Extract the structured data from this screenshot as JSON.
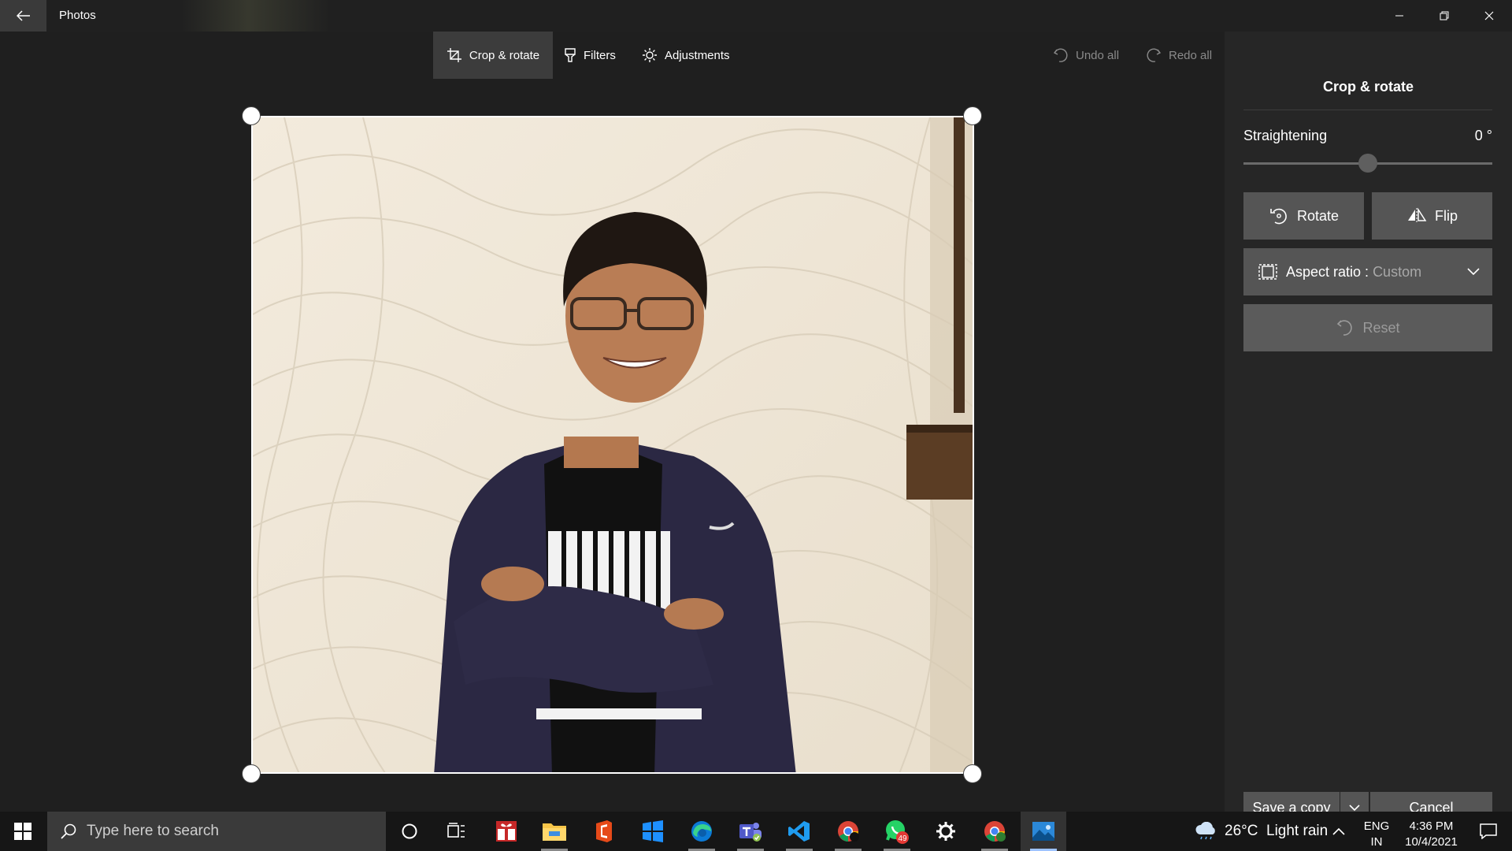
{
  "app": {
    "title": "Photos"
  },
  "toolbar": {
    "crop_label": "Crop & rotate",
    "filters_label": "Filters",
    "adjustments_label": "Adjustments",
    "undo_label": "Undo all",
    "redo_label": "Redo all"
  },
  "panel": {
    "title": "Crop & rotate",
    "straightening_label": "Straightening",
    "straightening_value": "0 °",
    "rotate_label": "Rotate",
    "flip_label": "Flip",
    "aspect_label": "Aspect ratio : ",
    "aspect_value": "Custom",
    "reset_label": "Reset",
    "save_label": "Save a copy",
    "cancel_label": "Cancel"
  },
  "taskbar": {
    "search_placeholder": "Type here to search",
    "whatsapp_badge": "49",
    "weather": "26°C  Light rain",
    "lang_line1": "ENG",
    "lang_line2": "IN",
    "time": "4:36 PM",
    "date": "10/4/2021"
  },
  "colors": {
    "app_bg": "#1f1f1f",
    "panel_bg": "#262626",
    "button_bg": "#555555",
    "active_tab": "#3c3c3c",
    "taskbar_bg": "#161616"
  }
}
